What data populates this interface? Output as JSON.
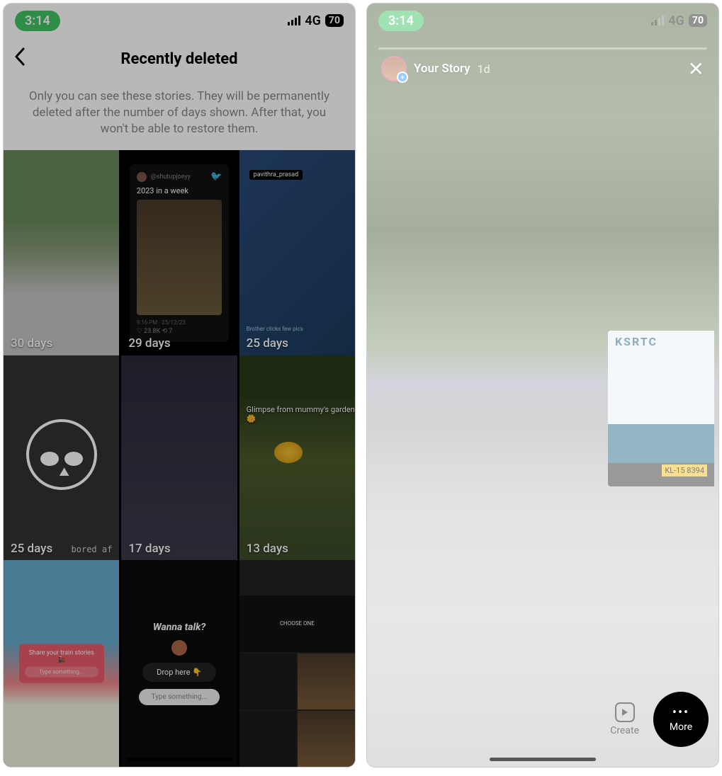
{
  "status": {
    "time": "3:14",
    "network": "4G",
    "battery": "70"
  },
  "left": {
    "header_title": "Recently deleted",
    "info_text": "Only you can see these stories. They will be permanently deleted after the number of days shown. After that, you won't be able to restore them.",
    "tiles": [
      {
        "days": "30 days"
      },
      {
        "days": "29 days",
        "tweet_handle": "@shutupjoeyy",
        "tweet_text": "2023 in a week",
        "tweet_meta": "9:16 PM · 25/12/23",
        "tweet_stats": "♡ 23.8K   ⟲ 7"
      },
      {
        "days": "25 days",
        "tag": "pavithra_prasad",
        "note": "Brother clicks few pics"
      },
      {
        "days": "25 days",
        "caption": "bored af"
      },
      {
        "days": "17 days"
      },
      {
        "days": "13 days",
        "caption": "Glimpse from mummy's garden 🌼"
      },
      {
        "days": "",
        "card_title": "Share your train stories 🚂",
        "card_placeholder": "Type something..."
      },
      {
        "days": "",
        "title": "Wanna talk?",
        "drop": "Drop here 👇",
        "placeholder": "Type something..."
      },
      {
        "days": "",
        "choose": "CHOOSE ONE"
      }
    ]
  },
  "right": {
    "story_name": "Your Story",
    "story_time": "1d",
    "bus_text": "KSRTC",
    "bus_plate": "KL-15 8394",
    "create_label": "Create",
    "more_label": "More"
  }
}
